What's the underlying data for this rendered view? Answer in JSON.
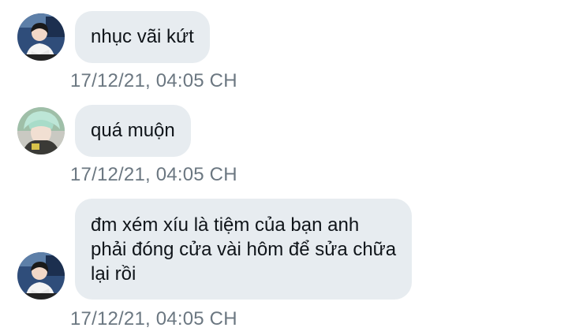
{
  "messages": [
    {
      "sender": "user-1",
      "lines": [
        "nhục vãi kứt"
      ],
      "timestamp": "17/12/21, 04:05 CH"
    },
    {
      "sender": "user-2",
      "lines": [
        "quá muộn"
      ],
      "timestamp": "17/12/21, 04:05 CH"
    },
    {
      "sender": "user-1",
      "lines": [
        "đm xém xíu là tiệm của bạn anh",
        "phải đóng cửa vài hôm để sửa chữa",
        "lại rồi"
      ],
      "timestamp": "17/12/21, 04:05 CH"
    }
  ],
  "colors": {
    "bubble_bg": "#e7ecf0",
    "text": "#0f1419",
    "timestamp": "#6b7781"
  }
}
